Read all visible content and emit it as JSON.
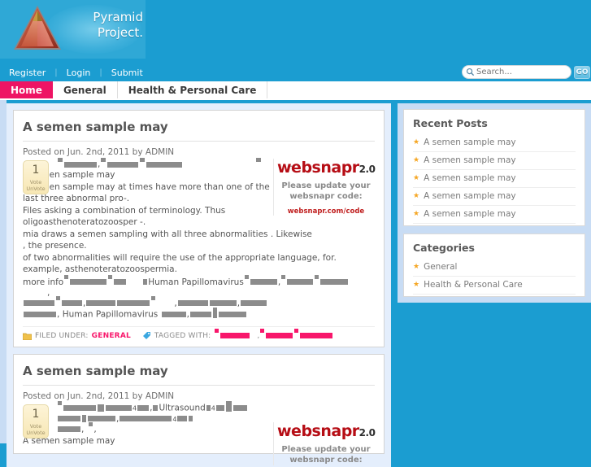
{
  "site": {
    "logo_line1": "Pyramid",
    "logo_line2": "Project.",
    "brand_blue": "#1b9dd1",
    "accent_pink": "#ee1464"
  },
  "topnav": {
    "items": [
      {
        "label": "Register"
      },
      {
        "label": "Login"
      },
      {
        "label": "Submit"
      }
    ],
    "separator": "|"
  },
  "search": {
    "placeholder": "Search...",
    "value": "",
    "go_label": "GO",
    "icon": "search-icon"
  },
  "tabs": [
    {
      "label": "Home",
      "active": true
    },
    {
      "label": "General",
      "active": false
    },
    {
      "label": "Health & Personal Care",
      "active": false
    }
  ],
  "posts": [
    {
      "title": "A semen sample may",
      "meta": "Posted on Jun. 2nd, 2011 by ADMIN",
      "vote": {
        "count": "1",
        "vote_label": "Vote",
        "unvote_label": "UnVote"
      },
      "body_lines": [
        "A semen sample may",
        "A semen sample may at times have more than one of the",
        "last three abnormal pro-.",
        "Files asking a combination of terminology. Thus",
        "oligoasthenoteratozoosper -.",
        "mia draws a semen sampling with all three abnormalities . Likewise",
        ", the presence.",
        "of two abnormalities will require the use of the appropriate language, for.",
        "example, asthenoteratozoospermia."
      ],
      "more_info_label": "more info",
      "redacted_term_1": "Human Papillomavirus",
      "redacted_term_2": "Human Papillomavirus",
      "websnapr": {
        "logo": "websnapr",
        "version": "2.0",
        "message_line1": "Please update your",
        "message_line2": "websnapr code:",
        "link": "websnapr.com/code"
      },
      "footer": {
        "filed_under_label": "FILED UNDER:",
        "category": "GENERAL",
        "tagged_with_label": "TAGGED WITH:",
        "folder_icon": "folder-icon",
        "tag_icon": "tag-icon"
      }
    },
    {
      "title": "A semen sample may",
      "meta": "Posted on Jun. 2nd, 2011 by ADMIN",
      "vote": {
        "count": "1",
        "vote_label": "Vote",
        "unvote_label": "UnVote"
      },
      "redacted_term_1": "Ultrasound",
      "redacted_num_1": "4",
      "redacted_num_2": "4",
      "redacted_num_3": "4",
      "body_lines": [
        "A semen sample may"
      ],
      "websnapr": {
        "logo": "websnapr",
        "version": "2.0",
        "message_line1": "Please update your",
        "message_line2": "websnapr code:"
      }
    }
  ],
  "sidebar": {
    "recent_posts": {
      "title": "Recent Posts",
      "items": [
        {
          "label": "A semen sample may"
        },
        {
          "label": "A semen sample may"
        },
        {
          "label": "A semen sample may"
        },
        {
          "label": "A semen sample may"
        },
        {
          "label": "A semen sample may"
        }
      ]
    },
    "categories": {
      "title": "Categories",
      "items": [
        {
          "label": "General"
        },
        {
          "label": "Health & Personal Care"
        }
      ]
    },
    "bullet_icon": "star-icon"
  }
}
